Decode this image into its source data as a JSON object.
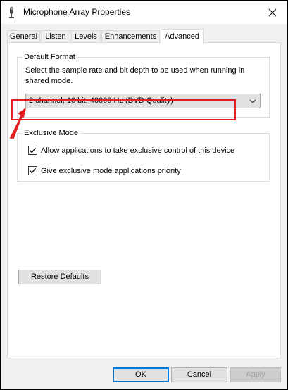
{
  "window": {
    "title": "Microphone Array Properties"
  },
  "tabs": [
    {
      "label": "General"
    },
    {
      "label": "Listen"
    },
    {
      "label": "Levels"
    },
    {
      "label": "Enhancements"
    },
    {
      "label": "Advanced",
      "active": true
    }
  ],
  "default_format": {
    "group_label": "Default Format",
    "description": "Select the sample rate and bit depth to be used when running in shared mode.",
    "selected_value": "2 channel, 16 bit, 48000 Hz (DVD Quality)"
  },
  "exclusive_mode": {
    "group_label": "Exclusive Mode",
    "allow_label": "Allow applications to take exclusive control of this device",
    "allow_checked": true,
    "priority_label": "Give exclusive mode applications priority",
    "priority_checked": true
  },
  "buttons": {
    "restore_defaults": "Restore Defaults",
    "ok": "OK",
    "cancel": "Cancel",
    "apply": "Apply"
  },
  "colors": {
    "annotation": "#e02020",
    "accent": "#0078d7"
  }
}
